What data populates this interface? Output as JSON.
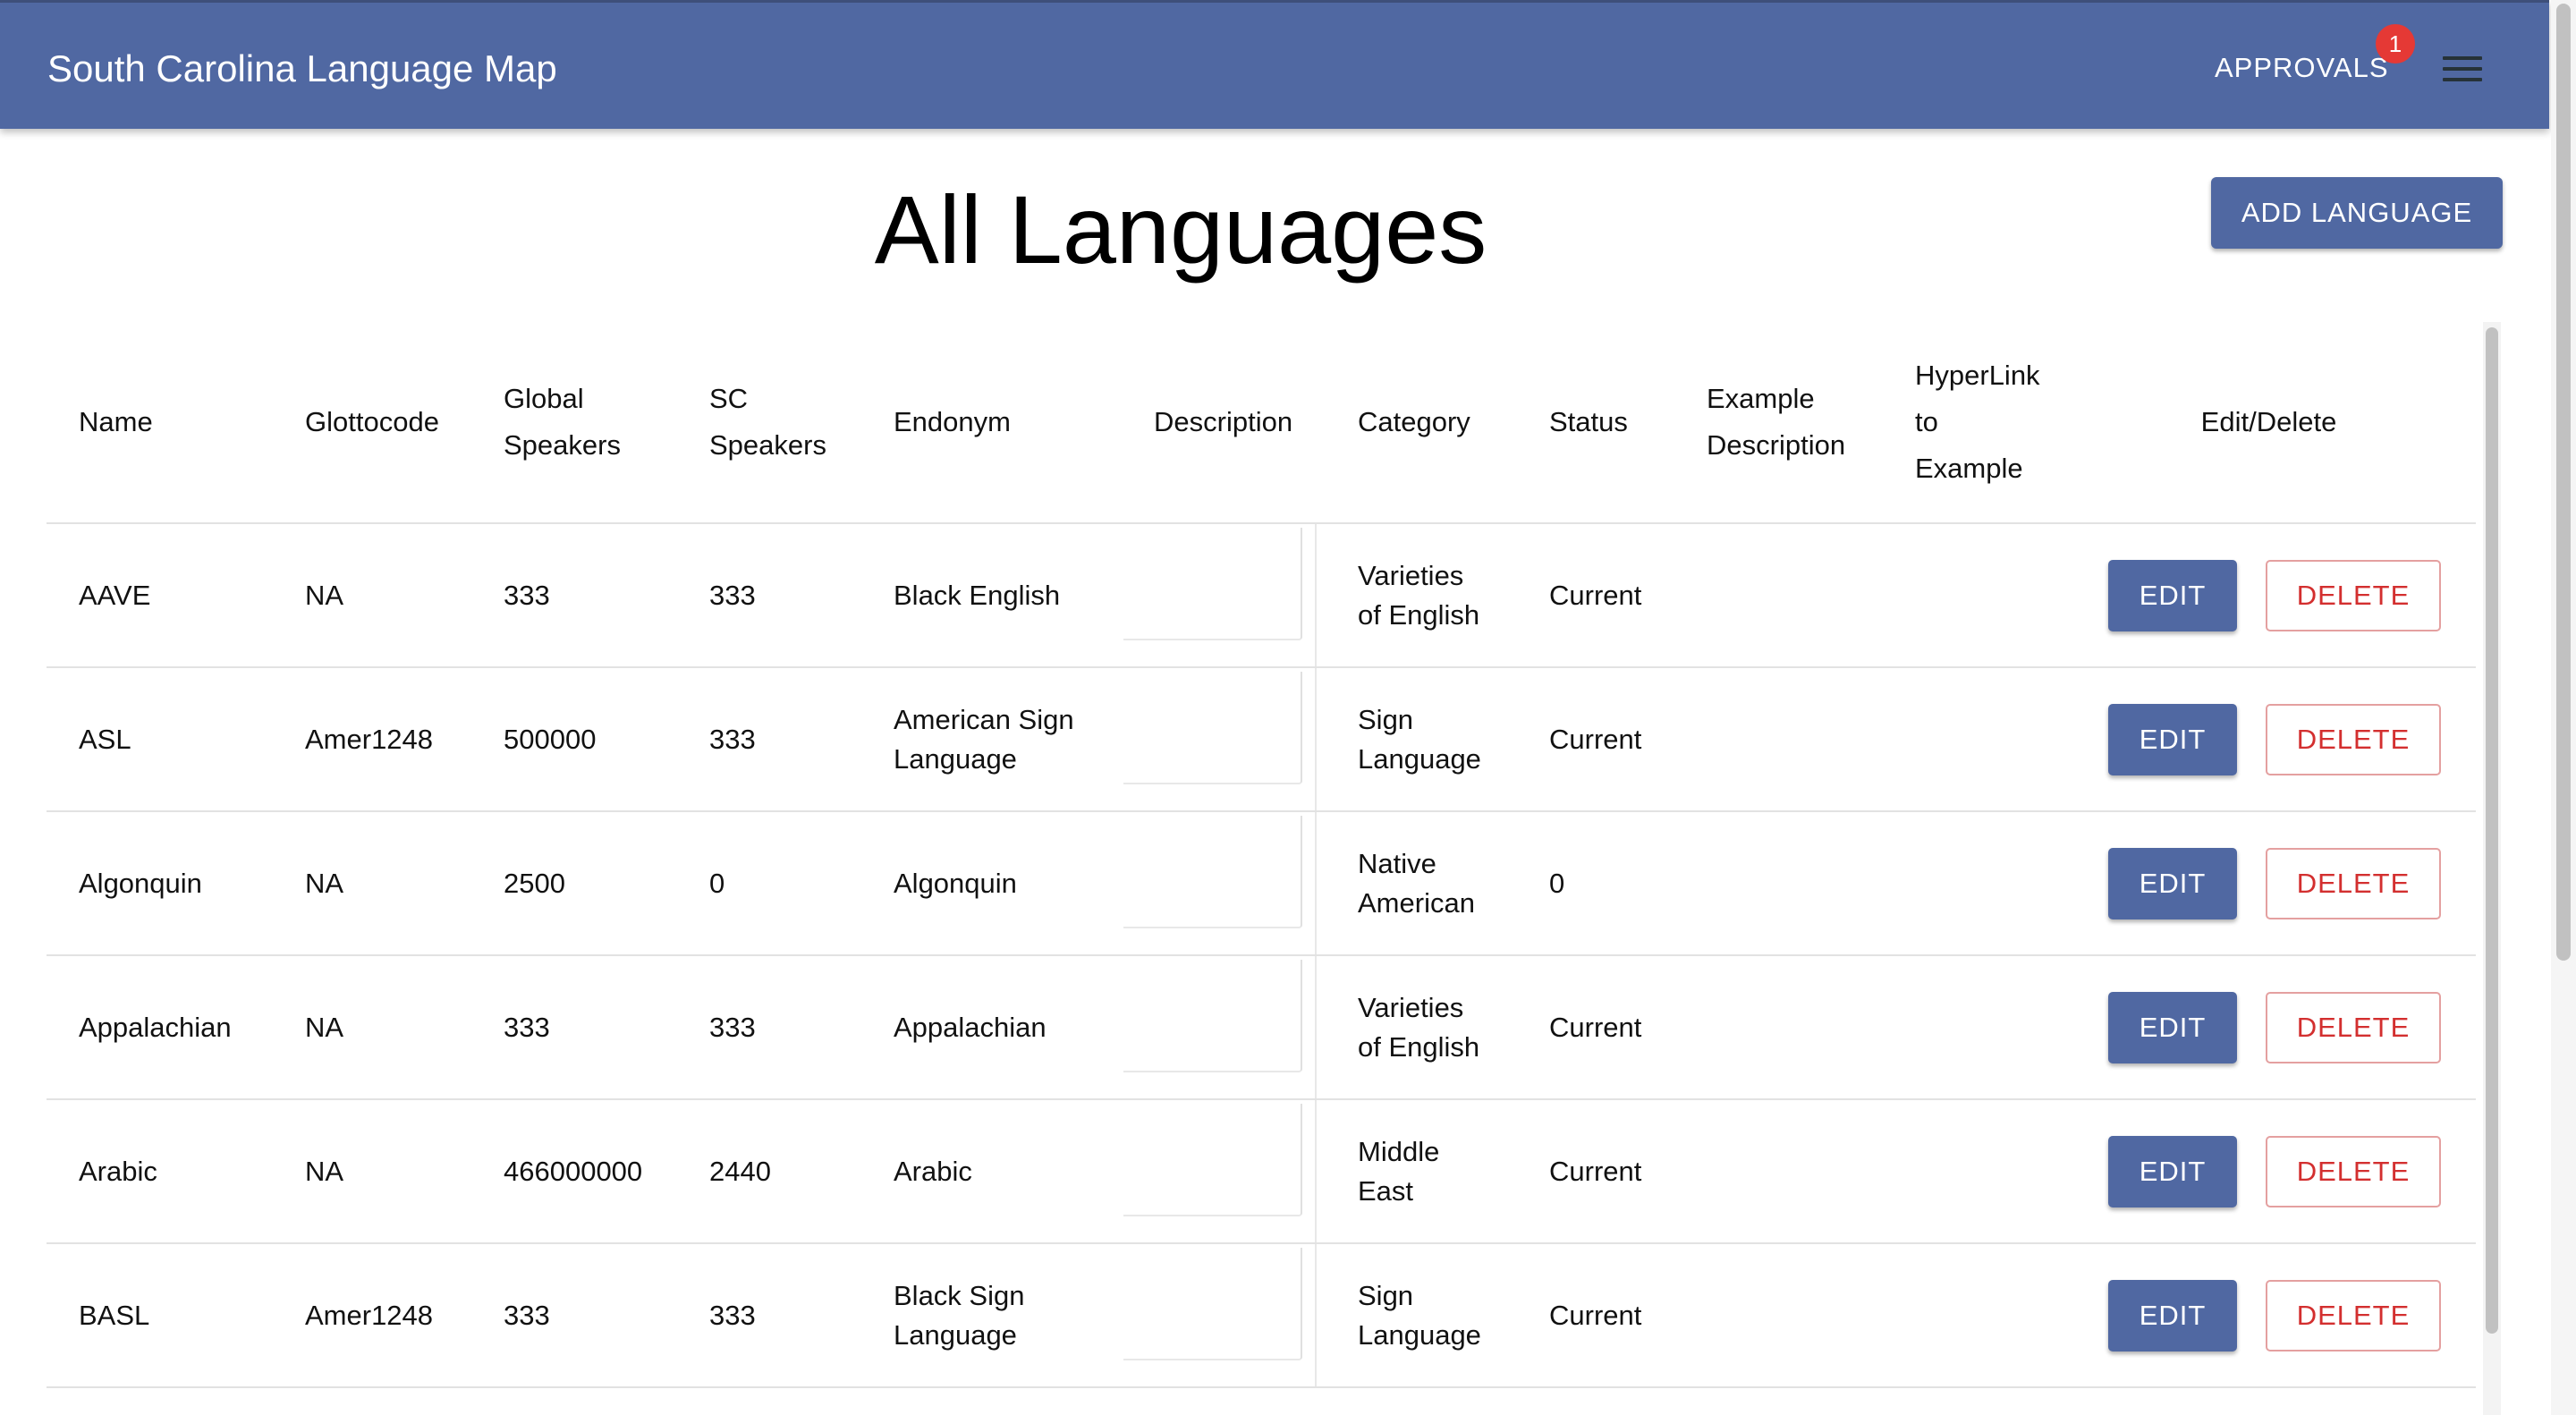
{
  "app": {
    "title": "South Carolina Language Map"
  },
  "header": {
    "approvals_label": "APPROVALS",
    "approvals_badge": "1",
    "menu_icon": "hamburger-menu-icon"
  },
  "main": {
    "title": "All Languages",
    "add_button": "ADD LANGUAGE"
  },
  "table": {
    "columns": {
      "name": "Name",
      "glottocode": "Glottocode",
      "global_speakers": [
        "Global",
        "Speakers"
      ],
      "sc_speakers": [
        "SC",
        "Speakers"
      ],
      "endonym": "Endonym",
      "description": "Description",
      "category": "Category",
      "status": "Status",
      "example_description": [
        "Example",
        "Description"
      ],
      "hyperlink": [
        "HyperLink",
        "to",
        "Example"
      ],
      "edit_delete": "Edit/Delete"
    },
    "edit_label": "EDIT",
    "delete_label": "DELETE",
    "rows": [
      {
        "name": "AAVE",
        "glottocode": "NA",
        "global": "333",
        "sc": "333",
        "endonym": [
          "Black English"
        ],
        "category": [
          "Varieties",
          "of English"
        ],
        "status": "Current"
      },
      {
        "name": "ASL",
        "glottocode": "Amer1248",
        "global": "500000",
        "sc": "333",
        "endonym": [
          "American Sign",
          "Language"
        ],
        "category": [
          "Sign",
          "Language"
        ],
        "status": "Current"
      },
      {
        "name": "Algonquin",
        "glottocode": "NA",
        "global": "2500",
        "sc": "0",
        "endonym": [
          "Algonquin"
        ],
        "category": [
          "Native",
          "American"
        ],
        "status": "0"
      },
      {
        "name": "Appalachian",
        "glottocode": "NA",
        "global": "333",
        "sc": "333",
        "endonym": [
          "Appalachian"
        ],
        "category": [
          "Varieties",
          "of English"
        ],
        "status": "Current"
      },
      {
        "name": "Arabic",
        "glottocode": "NA",
        "global": "466000000",
        "sc": "2440",
        "endonym": [
          "Arabic"
        ],
        "category": [
          "Middle",
          "East"
        ],
        "status": "Current"
      },
      {
        "name": "BASL",
        "glottocode": "Amer1248",
        "global": "333",
        "sc": "333",
        "endonym": [
          "Black Sign",
          "Language"
        ],
        "category": [
          "Sign",
          "Language"
        ],
        "status": "Current"
      }
    ]
  }
}
